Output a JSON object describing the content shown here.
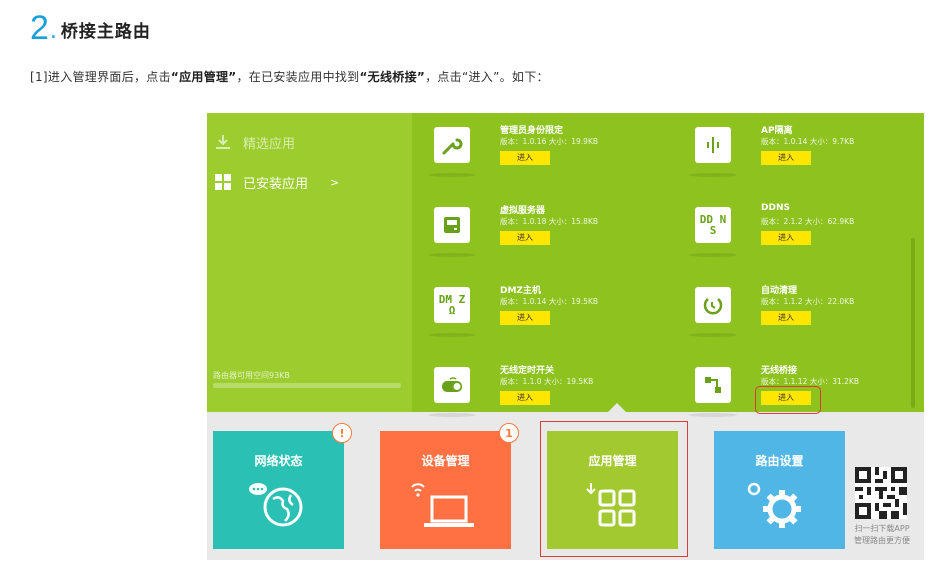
{
  "step": {
    "number": "2",
    "dot": ".",
    "title": "桥接主路由"
  },
  "instruction": {
    "prefix": "[1]进入管理界面后，点击",
    "q1": "“应用管理”",
    "mid": "，在已安装应用中找到",
    "q2": "“无线桥接”",
    "suffix": "，点击“进入”。如下："
  },
  "sidebar": {
    "items": [
      {
        "label": "精选应用",
        "icon": "download-icon"
      },
      {
        "label": "已安装应用",
        "icon": "grid-icon",
        "chevron": ">"
      }
    ],
    "storage_label": "路由器可用空间93KB",
    "storage_used_fraction": 0
  },
  "apps": [
    {
      "name": "管理员身份限定",
      "meta": "版本：1.0.16 大小：19.9KB",
      "icon": "wrench-icon",
      "button": "进入"
    },
    {
      "name": "AP隔离",
      "meta": "版本：1.0.14 大小：9.7KB",
      "icon": "ap-isolation-icon",
      "button": "进入"
    },
    {
      "name": "虚拟服务器",
      "meta": "版本：1.0.18 大小：15.8KB",
      "icon": "server-icon",
      "button": "进入"
    },
    {
      "name": "DDNS",
      "meta": "版本：2.1.2 大小：62.9KB",
      "icon": "ddns-icon",
      "icon_text": "DD NS",
      "button": "进入"
    },
    {
      "name": "DMZ主机",
      "meta": "版本：1.0.14 大小：19.5KB",
      "icon": "dmz-icon",
      "icon_text": "DM ZΩ",
      "button": "进入"
    },
    {
      "name": "自动清理",
      "meta": "版本：1.1.2 大小：22.0KB",
      "icon": "auto-clean-icon",
      "button": "进入"
    },
    {
      "name": "无线定时开关",
      "meta": "版本：1.1.0 大小：19.5KB",
      "icon": "wifi-timer-icon",
      "button": "进入"
    },
    {
      "name": "无线桥接",
      "meta": "版本：1.1.12 大小：31.2KB",
      "icon": "bridge-icon",
      "button": "进入"
    }
  ],
  "tiles": [
    {
      "label": "网络状态",
      "color": "#2bc0b4",
      "badge": "!"
    },
    {
      "label": "设备管理",
      "color": "#ff7043",
      "badge": "1"
    },
    {
      "label": "应用管理",
      "color": "#a3c931",
      "badge": ""
    },
    {
      "label": "路由设置",
      "color": "#4fb6e6",
      "badge": ""
    }
  ],
  "qr": {
    "line1": "扫一扫下载APP",
    "line2": "管理路由更方便"
  },
  "colors": {
    "accent_blue": "#19a0dc",
    "panel_green": "#8dc21f",
    "button_yellow": "#ffe600",
    "highlight_red": "#e03b3b"
  }
}
